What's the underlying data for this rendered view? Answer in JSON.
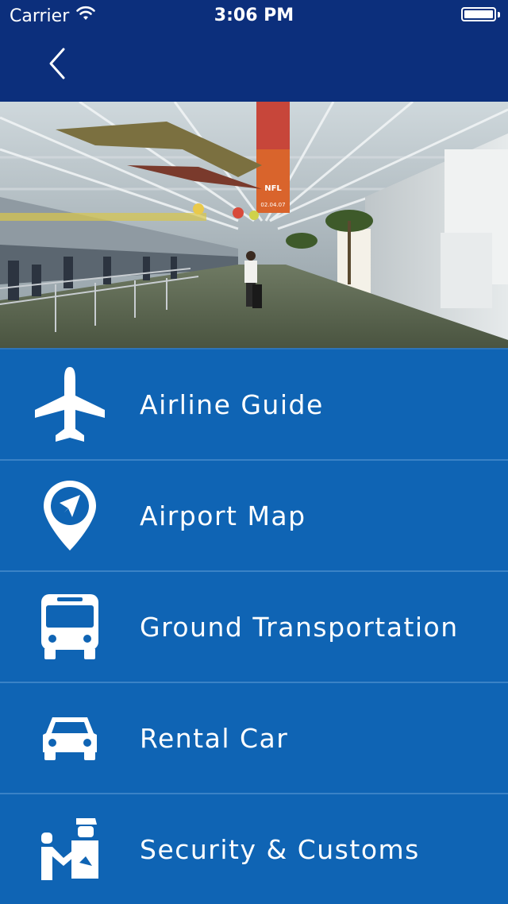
{
  "status_bar": {
    "carrier": "Carrier",
    "time": "3:06 PM"
  },
  "nav": {
    "back_icon": "chevron-left-icon"
  },
  "hero": {
    "banner_text": "NFL",
    "banner_date": "02.04.07"
  },
  "menu": {
    "items": [
      {
        "label": "Airline Guide",
        "icon": "airplane-icon"
      },
      {
        "label": "Airport Map",
        "icon": "map-pin-icon"
      },
      {
        "label": "Ground Transportation",
        "icon": "bus-icon"
      },
      {
        "label": "Rental Car",
        "icon": "car-icon"
      },
      {
        "label": "Security & Customs",
        "icon": "security-officer-icon"
      }
    ]
  },
  "colors": {
    "nav_bar": "#0c2f7c",
    "menu_background": "#0f64b4",
    "divider": "#3a82c6",
    "text": "#ffffff"
  }
}
